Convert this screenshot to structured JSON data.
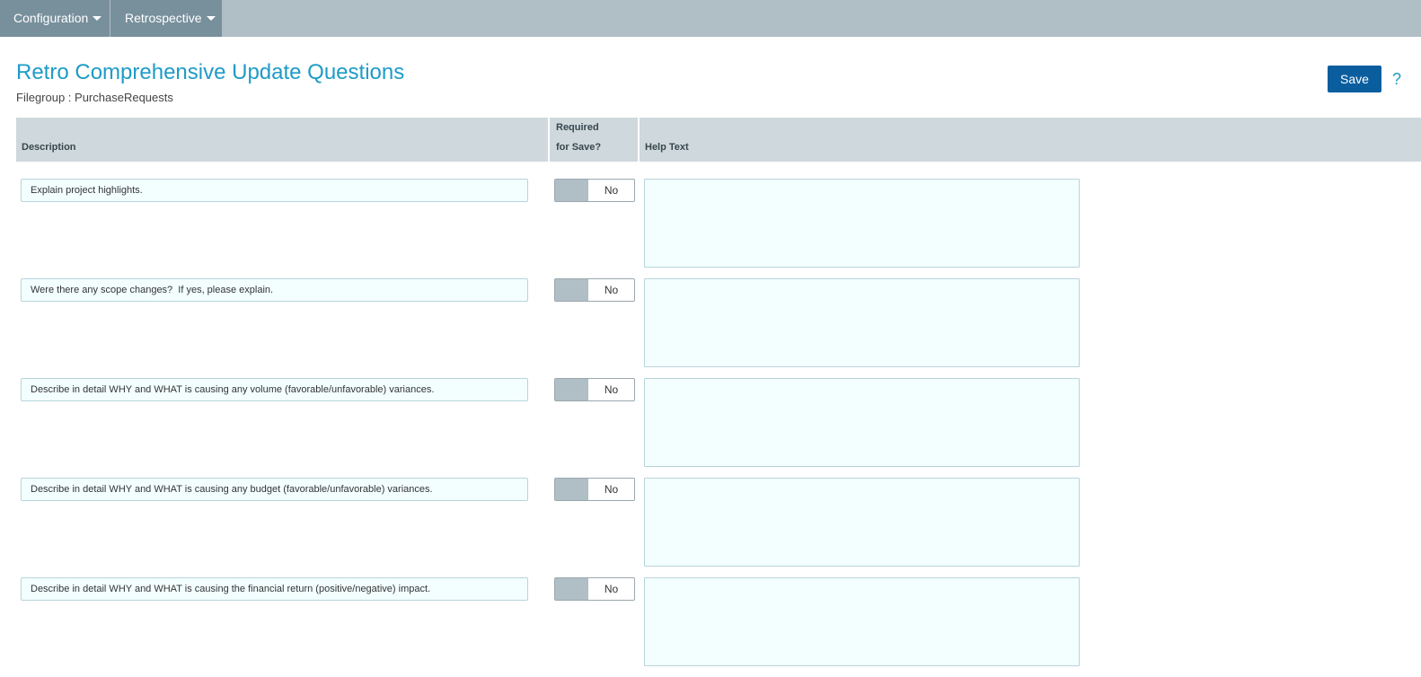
{
  "nav": {
    "items": [
      {
        "label": "Configuration"
      },
      {
        "label": "Retrospective"
      }
    ]
  },
  "header": {
    "title": "Retro Comprehensive Update Questions",
    "subtitle": "Filegroup : PurchaseRequests",
    "save_label": "Save",
    "help_symbol": "?"
  },
  "table": {
    "columns": {
      "description": "Description",
      "required_line1": "Required",
      "required_line2": "for Save?",
      "help_text": "Help Text"
    },
    "rows": [
      {
        "description": "Explain project highlights.",
        "required": "No",
        "help_text": ""
      },
      {
        "description": "Were there any scope changes?  If yes, please explain.",
        "required": "No",
        "help_text": ""
      },
      {
        "description": "Describe in detail WHY and WHAT is causing any volume (favorable/unfavorable) variances.",
        "required": "No",
        "help_text": ""
      },
      {
        "description": "Describe in detail WHY and WHAT is causing any budget (favorable/unfavorable) variances.",
        "required": "No",
        "help_text": ""
      },
      {
        "description": "Describe in detail WHY and WHAT is causing the financial return (positive/negative) impact.",
        "required": "No",
        "help_text": ""
      }
    ]
  },
  "colors": {
    "nav_bar": "#b0bec5",
    "nav_item": "#78909c",
    "title": "#1e9bc7",
    "save_button": "#0b5e9e",
    "table_header": "#cfd8dc",
    "field_background": "#f3ffff"
  },
  "icons": {
    "nav_caret": "chevron-down-icon",
    "help": "help-icon"
  }
}
